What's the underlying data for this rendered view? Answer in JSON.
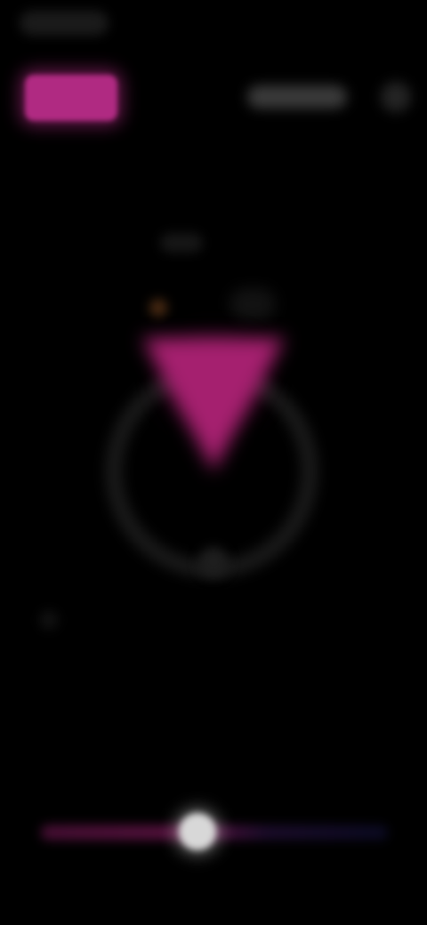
{
  "status_bar": {},
  "top_bar": {
    "colors": {
      "accent": "#b02a82",
      "pill": "#3a3a3a",
      "dot": "#242424"
    }
  },
  "main_visual": {
    "indicator": {
      "shape": "down-triangle-icon",
      "color": "#a5206f"
    },
    "dial": {
      "ring_color": "#181818"
    },
    "speck_color": "#4a2a12"
  },
  "slider": {
    "value_fraction": 0.45,
    "track_colors": [
      "#4a0f36",
      "#5a1241",
      "#1c0c2c",
      "#0b0b24"
    ],
    "thumb_color": "#d8d8d8"
  }
}
